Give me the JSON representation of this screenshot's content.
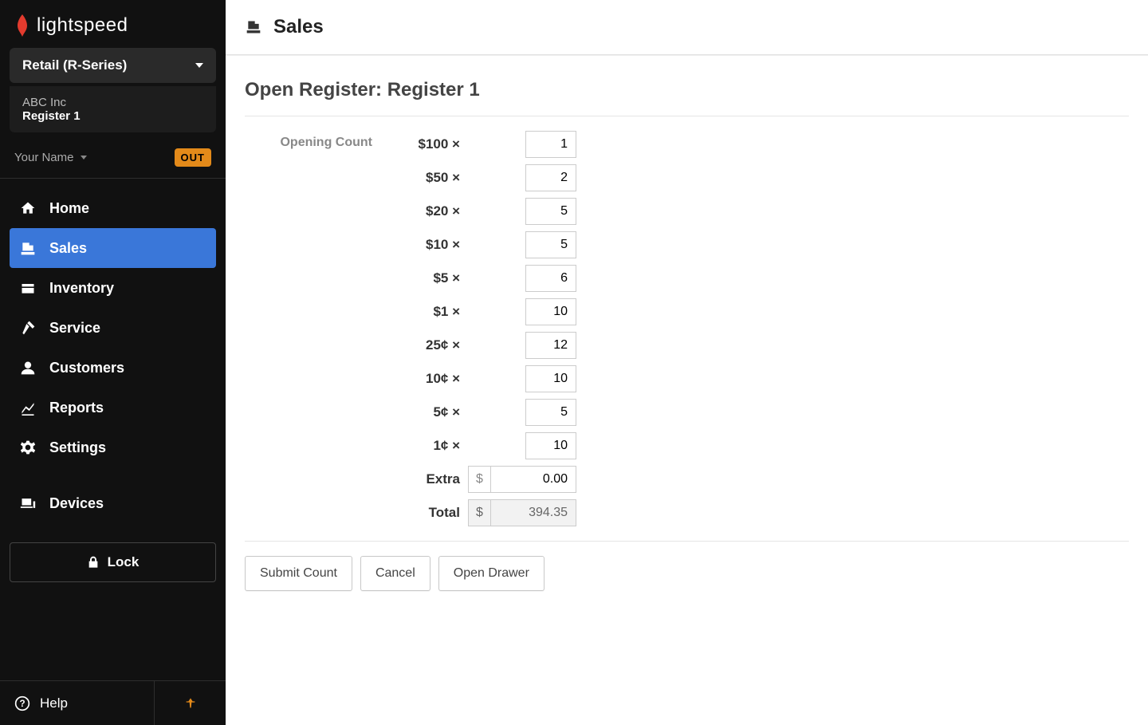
{
  "brand": "lightspeed",
  "product_line": "Retail (R-Series)",
  "shop": {
    "name": "ABC Inc",
    "register": "Register 1"
  },
  "user": {
    "name": "Your Name",
    "badge": "OUT"
  },
  "nav": {
    "home": "Home",
    "sales": "Sales",
    "inventory": "Inventory",
    "service": "Service",
    "customers": "Customers",
    "reports": "Reports",
    "settings": "Settings",
    "devices": "Devices"
  },
  "lock_label": "Lock",
  "help_label": "Help",
  "header": {
    "section": "Sales"
  },
  "page": {
    "title": "Open Register: Register 1",
    "opening_count_label": "Opening Count",
    "denominations": {
      "d100": {
        "label": "$100 ×",
        "value": "1"
      },
      "d50": {
        "label": "$50 ×",
        "value": "2"
      },
      "d20": {
        "label": "$20 ×",
        "value": "5"
      },
      "d10": {
        "label": "$10 ×",
        "value": "5"
      },
      "d5": {
        "label": "$5 ×",
        "value": "6"
      },
      "d1": {
        "label": "$1 ×",
        "value": "10"
      },
      "c25": {
        "label": "25¢ ×",
        "value": "12"
      },
      "c10": {
        "label": "10¢ ×",
        "value": "10"
      },
      "c5": {
        "label": "5¢ ×",
        "value": "5"
      },
      "c1": {
        "label": "1¢ ×",
        "value": "10"
      }
    },
    "extra_label": "Extra",
    "extra_value": "0.00",
    "total_label": "Total",
    "total_value": "394.35",
    "currency_symbol": "$",
    "buttons": {
      "submit": "Submit Count",
      "cancel": "Cancel",
      "open_drawer": "Open Drawer"
    }
  }
}
